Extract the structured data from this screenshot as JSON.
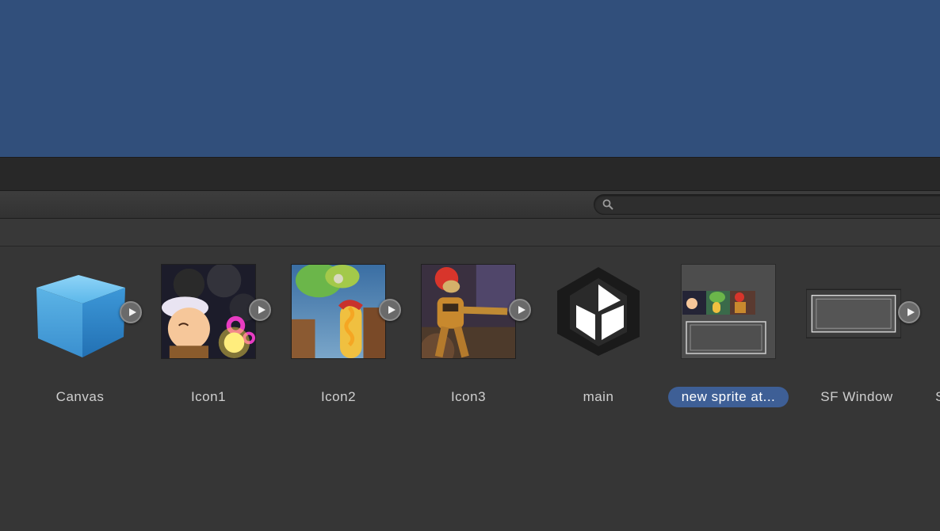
{
  "search": {
    "value": "",
    "placeholder": ""
  },
  "assets": [
    {
      "label": "Canvas",
      "icon": "prefab-cube-icon",
      "expandable": true
    },
    {
      "label": "Icon1",
      "icon": "sprite-thumbnail",
      "expandable": true
    },
    {
      "label": "Icon2",
      "icon": "sprite-thumbnail",
      "expandable": true
    },
    {
      "label": "Icon3",
      "icon": "sprite-thumbnail",
      "expandable": true
    },
    {
      "label": "main",
      "icon": "unity-scene-icon",
      "expandable": false
    },
    {
      "label": "new sprite at...",
      "icon": "sprite-atlas-thumbnail",
      "expandable": false,
      "selected": true
    },
    {
      "label": "SF Window",
      "icon": "sprite-window-thumbnail",
      "expandable": true
    },
    {
      "label": "S",
      "icon": "",
      "expandable": false
    }
  ],
  "colors": {
    "scene": "#314f7b",
    "panel": "#383838",
    "selection": "#3e5f96"
  }
}
